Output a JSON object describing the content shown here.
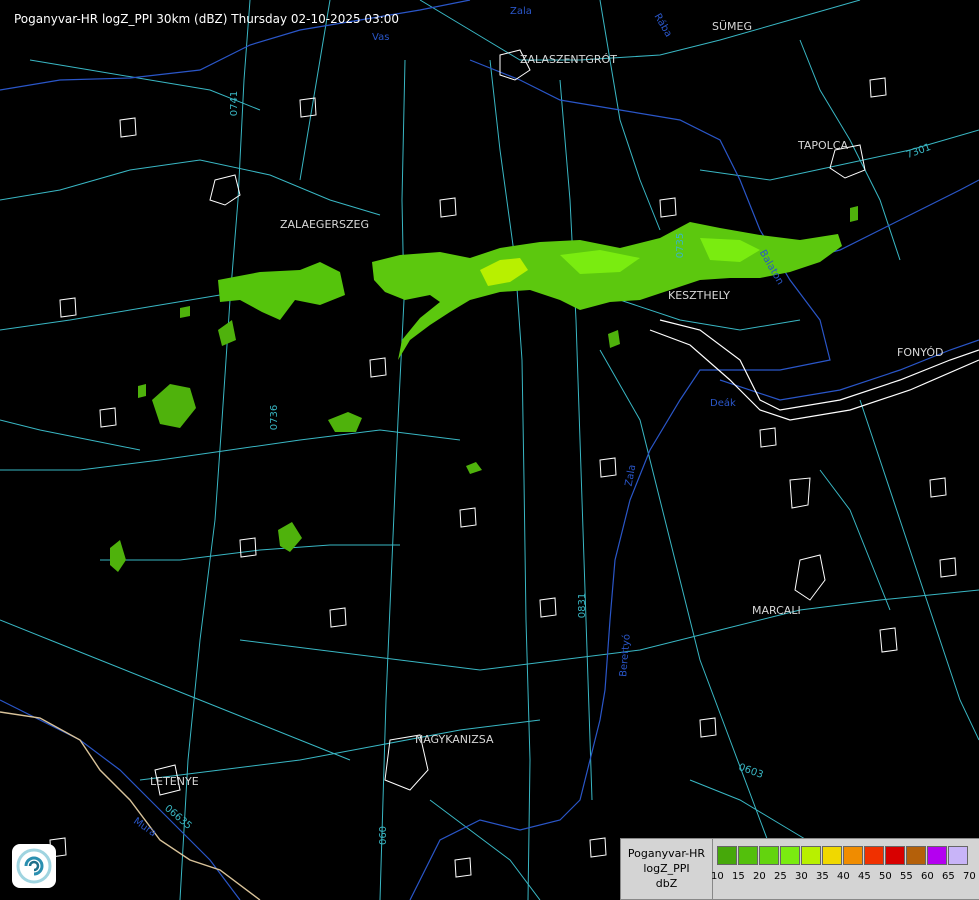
{
  "title": "Poganyvar-HR logZ_PPI 30km (dBZ) Thursday 02-10-2025 03:00",
  "cities": [
    "SÜMEG",
    "ZALASZENTGRÓT",
    "TAPOLCA",
    "ZALAEGERSZEG",
    "KESZTHELY",
    "FONYÓD",
    "MARCALI",
    "NAGYKANIZSA",
    "LETENYE"
  ],
  "road_labels": [
    "0741",
    "7301",
    "0735",
    "0736",
    "0831",
    "0603",
    "06635",
    "060"
  ],
  "river_labels": [
    "Zala",
    "Zala",
    "Vas",
    "Berettyó",
    "Rába",
    "Mura",
    "Deák",
    "Balaton"
  ],
  "legend": {
    "title_lines": [
      "Poganyvar-HR",
      "logZ_PPI",
      "dbZ"
    ],
    "ticks": [
      "10",
      "15",
      "20",
      "25",
      "30",
      "35",
      "40",
      "45",
      "50",
      "55",
      "60",
      "65",
      "70"
    ],
    "colors": [
      "#46a80a",
      "#53c00c",
      "#63d40e",
      "#7aec10",
      "#b8f000",
      "#f0d800",
      "#f08c00",
      "#f03000",
      "#d80000",
      "#b4600a",
      "#b400f0",
      "#c8b4f8"
    ]
  },
  "colors": {
    "background": "#000000",
    "roads": "#39b7c4",
    "rivers": "#2a56c8",
    "settlements": "#ffffff",
    "echo_weak": "#3fa00c",
    "echo_moderate": "#62d414",
    "echo_strong": "#c8f000"
  }
}
